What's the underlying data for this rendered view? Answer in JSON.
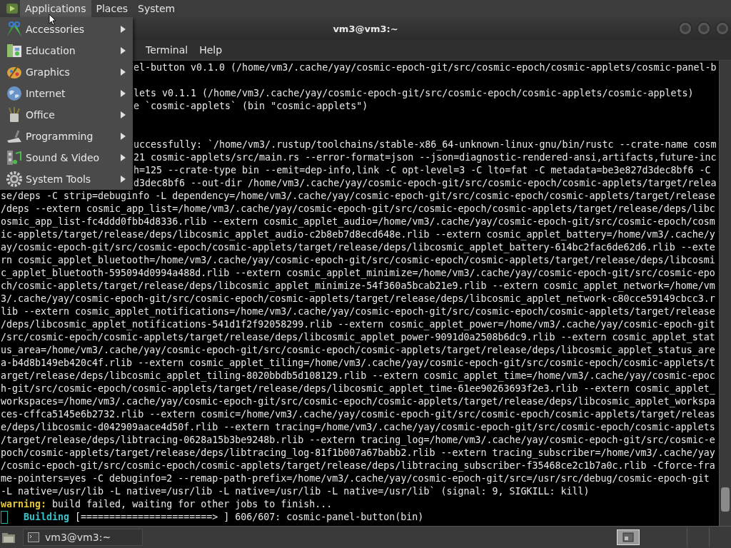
{
  "top_panel": {
    "menus": [
      {
        "label": "Applications",
        "selected": true
      },
      {
        "label": "Places",
        "selected": false
      },
      {
        "label": "System",
        "selected": false
      }
    ]
  },
  "app_menu": {
    "items": [
      {
        "label": "Accessories",
        "kind": "accessories"
      },
      {
        "label": "Education",
        "kind": "education"
      },
      {
        "label": "Graphics",
        "kind": "graphics"
      },
      {
        "label": "Internet",
        "kind": "internet"
      },
      {
        "label": "Office",
        "kind": "office"
      },
      {
        "label": "Programming",
        "kind": "programming"
      },
      {
        "label": "Sound & Video",
        "kind": "sound"
      },
      {
        "label": "System Tools",
        "kind": "tools"
      }
    ]
  },
  "window": {
    "title": "vm3@vm3:~",
    "menubar": [
      "Terminal",
      "Help"
    ]
  },
  "terminal": {
    "lines": [
      {
        "kind": "covered",
        "text": "el-button v0.1.0 (/home/vm3/.cache/yay/cosmic-epoch-git/src/cosmic-epoch/cosmic-applets/cosmic-panel-b"
      },
      {
        "kind": "blank"
      },
      {
        "kind": "covered",
        "text": "lets v0.1.1 (/home/vm3/.cache/yay/cosmic-epoch-git/src/cosmic-epoch/cosmic-applets/cosmic-applets)"
      },
      {
        "kind": "covered",
        "text": "e `cosmic-applets` (bin \"cosmic-applets\")"
      },
      {
        "kind": "blank"
      },
      {
        "kind": "blank"
      },
      {
        "kind": "covered",
        "text": "uccessfully: `/home/vm3/.rustup/toolchains/stable-x86_64-unknown-linux-gnu/bin/rustc --crate-name cosm"
      },
      {
        "kind": "covered",
        "text": "21 cosmic-applets/src/main.rs --error-format=json --json=diagnostic-rendered-ansi,artifacts,future-inc"
      },
      {
        "kind": "covered",
        "text": "h=125 --crate-type bin --emit=dep-info,link -C opt-level=3 -C lto=fat -C metadata=be3e827d3dec8bf6 -C"
      },
      {
        "kind": "covered",
        "text": "d3dec8bf6 --out-dir /home/vm3/.cache/yay/cosmic-epoch-git/src/cosmic-epoch/cosmic-applets/target/relea"
      },
      {
        "kind": "full",
        "text": "se/deps -C strip=debuginfo -L dependency=/home/vm3/.cache/yay/cosmic-epoch-git/src/cosmic-epoch/cosmic-applets/target/release"
      },
      {
        "kind": "full",
        "text": "/deps --extern cosmic_app_list=/home/vm3/.cache/yay/cosmic-epoch-git/src/cosmic-epoch/cosmic-applets/target/release/deps/libc"
      },
      {
        "kind": "full",
        "text": "osmic_app_list-fc4ddd0fbb4d8336.rlib --extern cosmic_applet_audio=/home/vm3/.cache/yay/cosmic-epoch-git/src/cosmic-epoch/cosm"
      },
      {
        "kind": "full",
        "text": "ic-applets/target/release/deps/libcosmic_applet_audio-c2b8eb7d8ecd648e.rlib --extern cosmic_applet_battery=/home/vm3/.cache/y"
      },
      {
        "kind": "full",
        "text": "ay/cosmic-epoch-git/src/cosmic-epoch/cosmic-applets/target/release/deps/libcosmic_applet_battery-614bc2fac6de62d6.rlib --exte"
      },
      {
        "kind": "full",
        "text": "rn cosmic_applet_bluetooth=/home/vm3/.cache/yay/cosmic-epoch-git/src/cosmic-epoch/cosmic-applets/target/release/deps/libcosmi"
      },
      {
        "kind": "full",
        "text": "c_applet_bluetooth-595094d0994a488d.rlib --extern cosmic_applet_minimize=/home/vm3/.cache/yay/cosmic-epoch-git/src/cosmic-epo"
      },
      {
        "kind": "full",
        "text": "ch/cosmic-applets/target/release/deps/libcosmic_applet_minimize-54f360a5bcab21e9.rlib --extern cosmic_applet_network=/home/vm"
      },
      {
        "kind": "full",
        "text": "3/.cache/yay/cosmic-epoch-git/src/cosmic-epoch/cosmic-applets/target/release/deps/libcosmic_applet_network-c80cce59149cbcc3.r"
      },
      {
        "kind": "full",
        "text": "lib --extern cosmic_applet_notifications=/home/vm3/.cache/yay/cosmic-epoch-git/src/cosmic-epoch/cosmic-applets/target/release"
      },
      {
        "kind": "full",
        "text": "/deps/libcosmic_applet_notifications-541d1f2f92058299.rlib --extern cosmic_applet_power=/home/vm3/.cache/yay/cosmic-epoch-git"
      },
      {
        "kind": "full",
        "text": "/src/cosmic-epoch/cosmic-applets/target/release/deps/libcosmic_applet_power-9091d0a2508b6dc9.rlib --extern cosmic_applet_stat"
      },
      {
        "kind": "full",
        "text": "us_area=/home/vm3/.cache/yay/cosmic-epoch-git/src/cosmic-epoch/cosmic-applets/target/release/deps/libcosmic_applet_status_are"
      },
      {
        "kind": "full",
        "text": "a-b4d8b149eb420c4f.rlib --extern cosmic_applet_tiling=/home/vm3/.cache/yay/cosmic-epoch-git/src/cosmic-epoch/cosmic-applets/t"
      },
      {
        "kind": "full",
        "text": "arget/release/deps/libcosmic_applet_tiling-8020bbdb5d108129.rlib --extern cosmic_applet_time=/home/vm3/.cache/yay/cosmic-epoc"
      },
      {
        "kind": "full",
        "text": "h-git/src/cosmic-epoch/cosmic-applets/target/release/deps/libcosmic_applet_time-61ee90263693f2e3.rlib --extern cosmic_applet_"
      },
      {
        "kind": "full",
        "text": "workspaces=/home/vm3/.cache/yay/cosmic-epoch-git/src/cosmic-epoch/cosmic-applets/target/release/deps/libcosmic_applet_workspa"
      },
      {
        "kind": "full",
        "text": "ces-cffca5145e6b2732.rlib --extern cosmic=/home/vm3/.cache/yay/cosmic-epoch-git/src/cosmic-epoch/cosmic-applets/target/releas"
      },
      {
        "kind": "full",
        "text": "e/deps/libcosmic-d042909aace4d50f.rlib --extern tracing=/home/vm3/.cache/yay/cosmic-epoch-git/src/cosmic-epoch/cosmic-applets"
      },
      {
        "kind": "full",
        "text": "/target/release/deps/libtracing-0628a15b3be9248b.rlib --extern tracing_log=/home/vm3/.cache/yay/cosmic-epoch-git/src/cosmic-e"
      },
      {
        "kind": "full",
        "text": "poch/cosmic-applets/target/release/deps/libtracing_log-81f1b007a67babb2.rlib --extern tracing_subscriber=/home/vm3/.cache/yay"
      },
      {
        "kind": "full",
        "text": "/cosmic-epoch-git/src/cosmic-epoch/cosmic-applets/target/release/deps/libtracing_subscriber-f35468ce2c1b7a0c.rlib -Cforce-fra"
      },
      {
        "kind": "full",
        "text": "me-pointers=yes -C debuginfo=2 --remap-path-prefix=/home/vm3/.cache/yay/cosmic-epoch-git/src=/usr/src/debug/cosmic-epoch-git"
      },
      {
        "kind": "full",
        "text": "-L native=/usr/lib -L native=/usr/lib -L native=/usr/lib -L native=/usr/lib` (signal: 9, SIGKILL: kill)"
      },
      {
        "kind": "warning",
        "label": "warning:",
        "text": " build failed, waiting for other jobs to finish..."
      },
      {
        "kind": "progress",
        "label": "Building",
        "text": "[=======================> ] 606/607: cosmic-panel-button(bin)"
      }
    ]
  },
  "taskbar": {
    "tasks": [
      {
        "label": "vm3@vm3:~"
      }
    ]
  }
}
